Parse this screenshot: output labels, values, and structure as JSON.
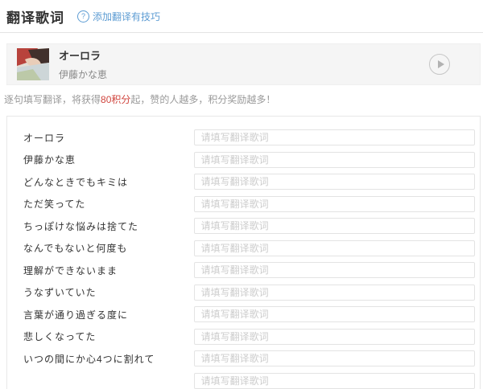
{
  "colors": {
    "link_blue": "#5d9cd3",
    "highlight_red": "#d0453e",
    "text_dark": "#333333",
    "text_gray": "#888888",
    "placeholder_gray": "#cccccc",
    "card_bg": "#f5f5f5"
  },
  "header": {
    "title": "翻译歌词",
    "help_icon": "?",
    "tips_link": "添加翻译有技巧"
  },
  "song": {
    "title": "オーロラ",
    "artist": "伊藤かな恵"
  },
  "notice": {
    "prefix": "逐句填写翻译，将获得",
    "points": "80积分",
    "suffix": "起，赞的人越多，积分奖励越多！"
  },
  "form": {
    "placeholder": "请填写翻译歌词",
    "lines": [
      "オーロラ",
      "伊藤かな恵",
      "どんなときでもキミは",
      "ただ笑ってた",
      "ちっぽけな悩みは捨てた",
      "なんでもないと何度も",
      "理解ができないまま",
      "うなずいていた",
      "言葉が通り過ぎる度に",
      "悲しくなってた",
      "いつの間にか心4つに割れて"
    ]
  }
}
